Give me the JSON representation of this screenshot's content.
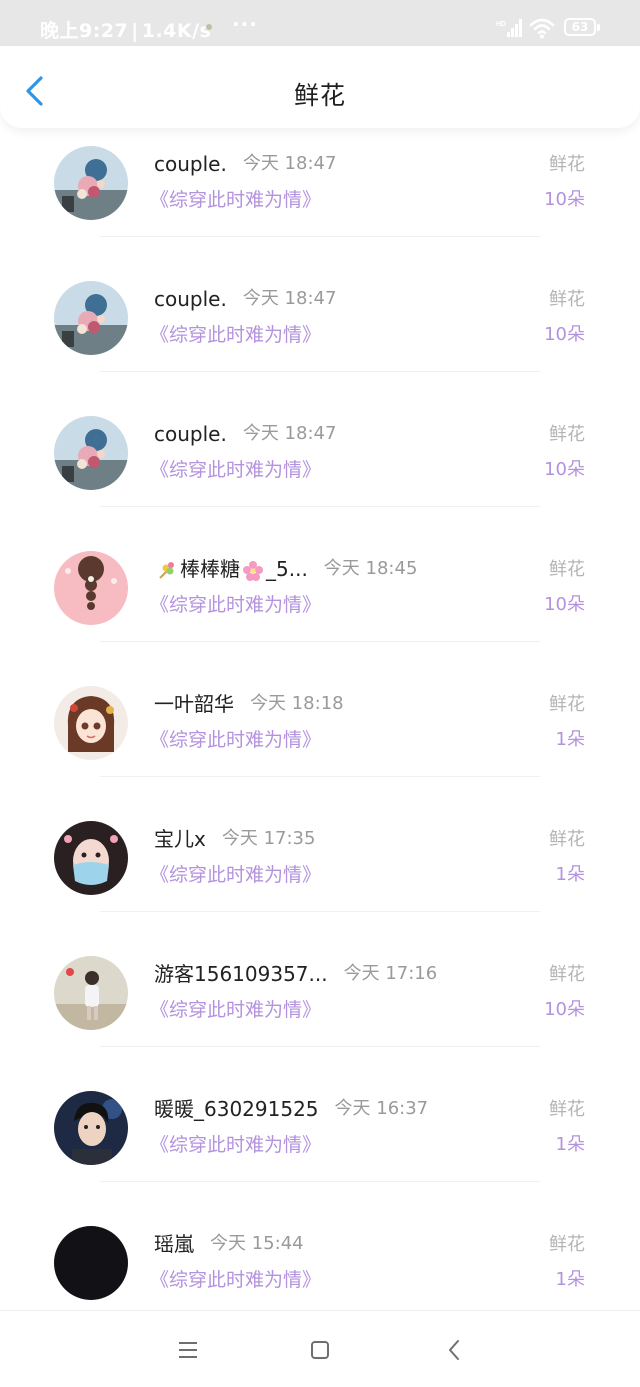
{
  "status_bar": {
    "time": "晚上9:27",
    "net_speed": "1.4K/s",
    "more": "···",
    "battery_level": "63",
    "network_label": "HD"
  },
  "header": {
    "title": "鲜花"
  },
  "colors": {
    "title_text": "#1f1f1f",
    "book_title": "#b392de",
    "gift_count": "#b392de",
    "gift_type": "#b4b4b4",
    "time_text": "#9a9a9a",
    "back_arrow": "#2f95e8"
  },
  "items": [
    {
      "name": "couple.",
      "time": "今天 18:47",
      "book": "《综穿此时难为情》",
      "gift_type": "鲜花",
      "gift_count": "10朵",
      "avatar": "flower-bouquet-photo"
    },
    {
      "name": "couple.",
      "time": "今天 18:47",
      "book": "《综穿此时难为情》",
      "gift_type": "鲜花",
      "gift_count": "10朵",
      "avatar": "flower-bouquet-photo"
    },
    {
      "name": "couple.",
      "time": "今天 18:47",
      "book": "《综穿此时难为情》",
      "gift_type": "鲜花",
      "gift_count": "10朵",
      "avatar": "flower-bouquet-photo"
    },
    {
      "name_prefix_icon": "candy-emoji",
      "name_main": "棒棒糖",
      "name_mid_icon": "sakura-emoji",
      "name_suffix": "_5...",
      "time": "今天 18:45",
      "book": "《综穿此时难为情》",
      "gift_type": "鲜花",
      "gift_count": "10朵",
      "avatar": "pink-braid-illustration"
    },
    {
      "name": "一叶韶华",
      "time": "今天 18:18",
      "book": "《综穿此时难为情》",
      "gift_type": "鲜花",
      "gift_count": "1朵",
      "avatar": "anime-girl-illustration"
    },
    {
      "name": "宝儿x",
      "time": "今天 17:35",
      "book": "《综穿此时难为情》",
      "gift_type": "鲜花",
      "gift_count": "1朵",
      "avatar": "masked-girl-photo"
    },
    {
      "name": "游客156109357...",
      "time": "今天 17:16",
      "book": "《综穿此时难为情》",
      "gift_type": "鲜花",
      "gift_count": "10朵",
      "avatar": "girl-outdoor-photo"
    },
    {
      "name": "暖暖_630291525",
      "time": "今天 16:37",
      "book": "《综穿此时难为情》",
      "gift_type": "鲜花",
      "gift_count": "1朵",
      "avatar": "boy-portrait-photo"
    },
    {
      "name": "瑶嵐",
      "time": "今天 15:44",
      "book": "《综穿此时难为情》",
      "gift_type": "鲜花",
      "gift_count": "1朵",
      "avatar": "black-avatar"
    }
  ]
}
